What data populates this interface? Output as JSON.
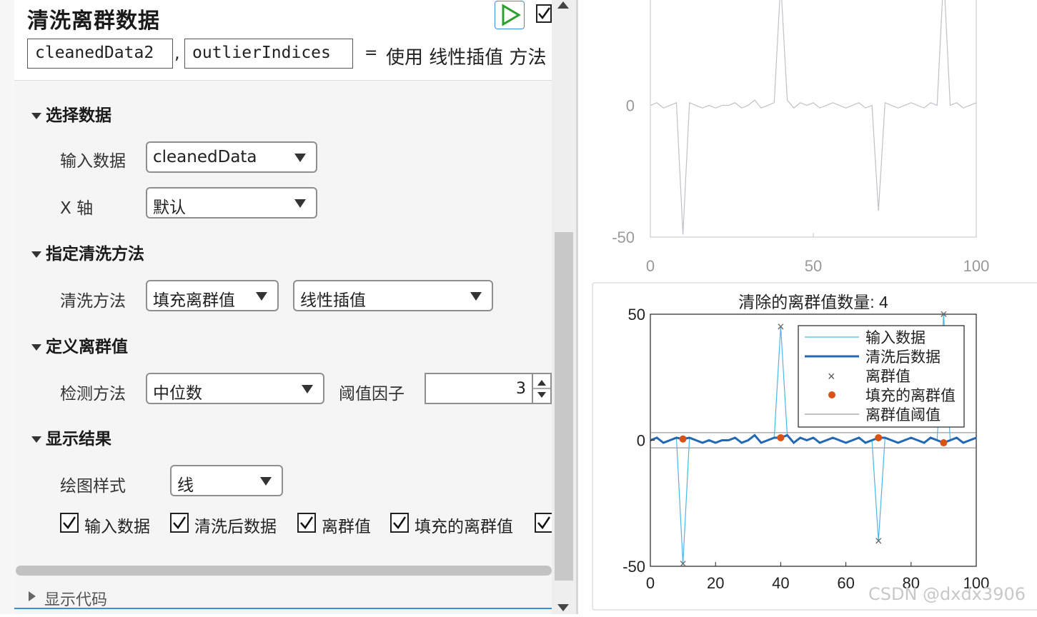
{
  "header": {
    "title": "清洗离群数据",
    "output_var1": "cleanedData2",
    "comma": ",",
    "output_var2": "outlierIndices",
    "equals": "=",
    "description": "使用 线性插值 方法"
  },
  "sections": {
    "select_data": {
      "heading": "选择数据",
      "input_label": "输入数据",
      "input_value": "cleanedData",
      "xaxis_label": "X 轴",
      "xaxis_value": "默认"
    },
    "method": {
      "heading": "指定清洗方法",
      "method_label": "清洗方法",
      "method_value": "填充离群值",
      "fill_value": "线性插值"
    },
    "define": {
      "heading": "定义离群值",
      "detect_label": "检测方法",
      "detect_value": "中位数",
      "threshold_label": "阈值因子",
      "threshold_value": "3"
    },
    "display": {
      "heading": "显示结果",
      "plotstyle_label": "绘图样式",
      "plotstyle_value": "线",
      "checkboxes": [
        "输入数据",
        "清洗后数据",
        "离群值",
        "填充的离群值"
      ]
    }
  },
  "footer": {
    "show_code": "显示代码"
  },
  "watermark": "CSDN @dxdx3906",
  "colors": {
    "accent": "#3b8fd9",
    "input_line": "#4db6e8",
    "cleaned_line": "#2268b4",
    "filled": "#d95319",
    "threshold": "#808080"
  },
  "icons": {
    "run": "play-icon",
    "check": "checkmark-icon",
    "dropdown": "triangle-down-icon"
  },
  "chart_data": [
    {
      "type": "line",
      "title": "",
      "x_ticks": [
        0,
        50,
        100
      ],
      "y_ticks": [
        -50,
        0
      ],
      "xlim": [
        0,
        100
      ],
      "ylim": [
        -50,
        40
      ],
      "series": [
        {
          "values_description_note": "",
          "x": [
            0,
            2,
            4,
            6,
            8,
            10,
            12,
            14,
            16,
            18,
            20,
            22,
            24,
            26,
            28,
            30,
            32,
            34,
            36,
            38,
            40,
            42,
            44,
            46,
            48,
            50,
            52,
            54,
            56,
            58,
            60,
            62,
            64,
            66,
            68,
            70,
            72,
            74,
            76,
            78,
            80,
            82,
            84,
            86,
            88,
            90,
            92,
            94,
            96,
            98,
            100
          ],
          "y": [
            0,
            1,
            -1,
            0,
            1,
            -49,
            1,
            0,
            -1,
            0,
            -1,
            0,
            0,
            1,
            -1,
            0,
            2,
            -1,
            0,
            1,
            47,
            2,
            -1,
            1,
            0,
            1,
            -1,
            0,
            1,
            0,
            -1,
            0,
            1,
            -1,
            0,
            -40,
            1,
            0,
            -1,
            0,
            1,
            0,
            -1,
            1,
            0,
            50,
            0,
            1,
            -1,
            0,
            1
          ]
        }
      ]
    },
    {
      "type": "line",
      "title": "清除的离群值数量: 4",
      "x_ticks": [
        0,
        20,
        40,
        60,
        80,
        100
      ],
      "y_ticks": [
        -50,
        0,
        50
      ],
      "xlim": [
        0,
        100
      ],
      "ylim": [
        -50,
        50
      ],
      "legend_position": "top-right",
      "legend": [
        "输入数据",
        "清洗后数据",
        "离群值",
        "填充的离群值",
        "离群值阈值"
      ],
      "thresholds": [
        3,
        -3
      ],
      "input_x": [
        0,
        2,
        4,
        6,
        8,
        10,
        12,
        14,
        16,
        18,
        20,
        22,
        24,
        26,
        28,
        30,
        32,
        34,
        36,
        38,
        40,
        42,
        44,
        46,
        48,
        50,
        52,
        54,
        56,
        58,
        60,
        62,
        64,
        66,
        68,
        70,
        72,
        74,
        76,
        78,
        80,
        82,
        84,
        86,
        88,
        90,
        92,
        94,
        96,
        98,
        100
      ],
      "input_y": [
        0,
        1,
        -1,
        0,
        1,
        -49,
        1,
        0,
        -1,
        0,
        -1,
        0,
        0,
        1,
        -1,
        0,
        2,
        -1,
        0,
        1,
        45,
        2,
        -1,
        1,
        0,
        1,
        -1,
        0,
        1,
        0,
        -1,
        0,
        1,
        -1,
        0,
        -40,
        1,
        0,
        -1,
        0,
        1,
        0,
        -1,
        1,
        0,
        50,
        0,
        1,
        -1,
        0,
        1
      ],
      "outliers": [
        [
          10,
          -49
        ],
        [
          40,
          45
        ],
        [
          70,
          -40
        ],
        [
          90,
          50
        ]
      ],
      "filled": [
        [
          10,
          0.5
        ],
        [
          40,
          1
        ],
        [
          70,
          1
        ],
        [
          90,
          -1
        ]
      ]
    }
  ]
}
